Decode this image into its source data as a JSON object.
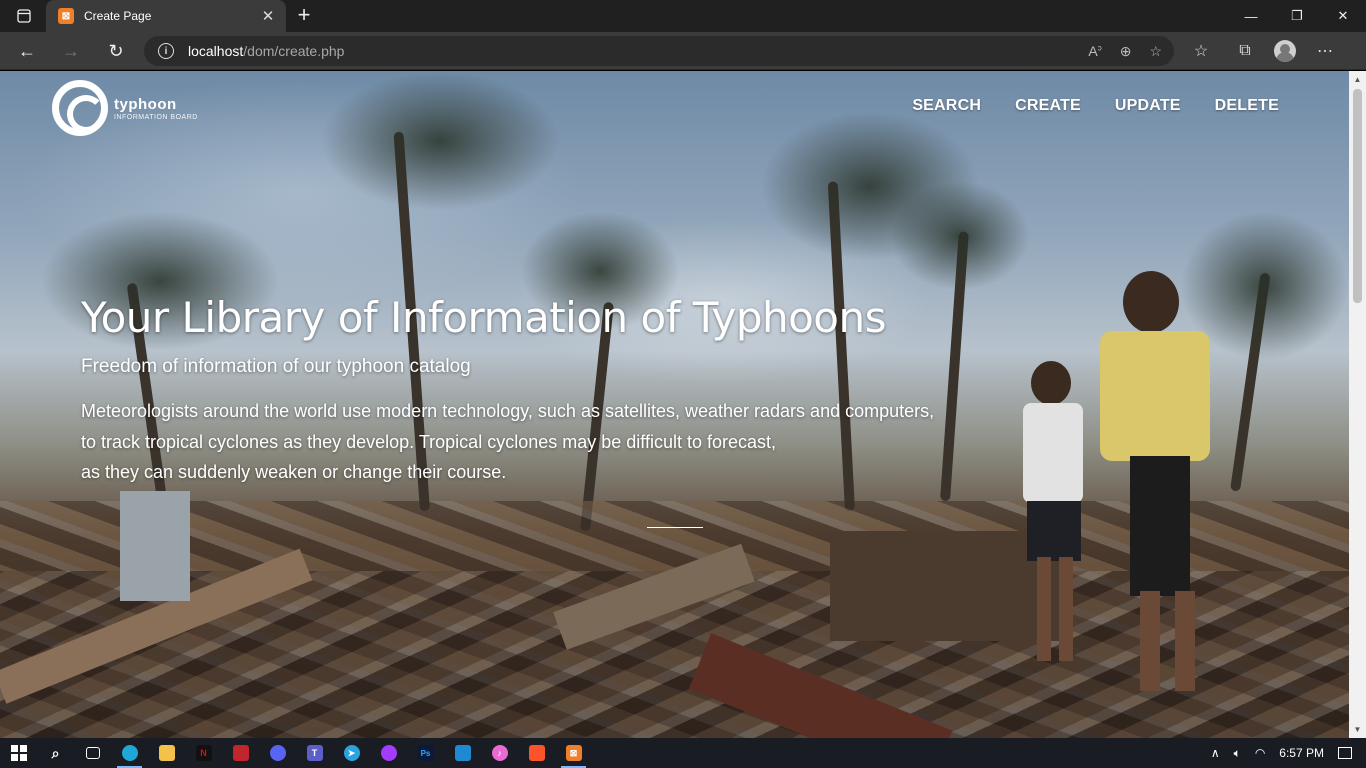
{
  "browser": {
    "tab_title": "Create Page",
    "url_host": "localhost",
    "url_path": "/dom/create.php"
  },
  "site": {
    "logo_name": "typhoon",
    "logo_sub": "INFORMATION BOARD",
    "nav": [
      "SEARCH",
      "CREATE",
      "UPDATE",
      "DELETE"
    ]
  },
  "hero": {
    "title": "Your Library of Information of Typhoons",
    "tagline": "Freedom of information of our typhoon catalog",
    "desc_line1": "Meteorologists around the world use modern technology, such as satellites, weather radars and computers,",
    "desc_line2": "to track tropical cyclones as they develop. Tropical cyclones may be difficult to forecast,",
    "desc_line3": "as they can suddenly weaken or change their course."
  },
  "taskbar": {
    "apps": [
      "windows-start",
      "search",
      "task-view",
      "edge",
      "file-explorer",
      "netflix",
      "app-red",
      "discord",
      "teams",
      "telegram",
      "messenger",
      "photoshop",
      "vscode",
      "itunes",
      "brave",
      "xampp"
    ],
    "clock": "6:57 PM"
  }
}
